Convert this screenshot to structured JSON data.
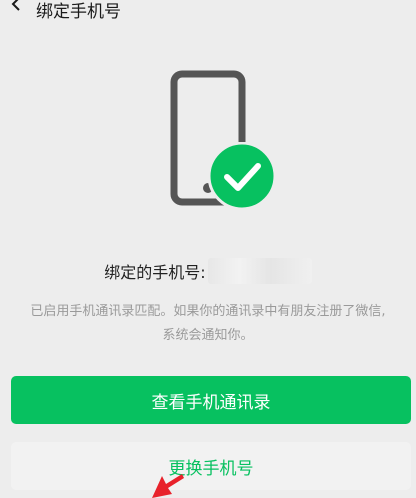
{
  "nav": {
    "title": "绑定手机号",
    "back_icon": "chevron-left-icon"
  },
  "status": {
    "icon": "phone-check-icon",
    "accent": "#07c160"
  },
  "bound": {
    "label": "绑定的手机号:"
  },
  "description": {
    "line1": "已启用手机通讯录匹配。如果你的通讯录中有朋友注册了微信,",
    "line2": "系统会通知你。"
  },
  "actions": {
    "view_contacts": "查看手机通讯录",
    "change_phone": "更换手机号"
  },
  "colors": {
    "primary": "#07c160",
    "annotation_arrow": "#e8222b"
  }
}
